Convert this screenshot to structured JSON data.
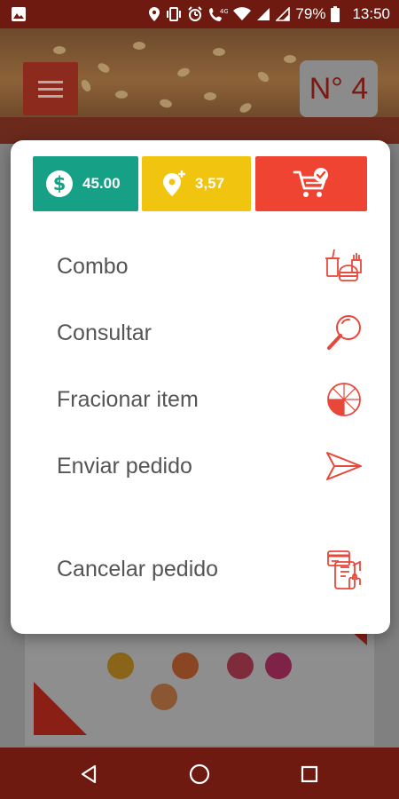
{
  "status_bar": {
    "battery": "79%",
    "time": "13:50"
  },
  "header": {
    "order_number": "N° 4"
  },
  "dialog": {
    "total_value": "45.00",
    "delivery_fee": "3,57",
    "menu_items": [
      {
        "label": "Combo",
        "icon": "combo-food-icon"
      },
      {
        "label": "Consultar",
        "icon": "magnifier-icon"
      },
      {
        "label": "Fracionar item",
        "icon": "pie-fraction-icon"
      },
      {
        "label": "Enviar pedido",
        "icon": "send-icon"
      },
      {
        "label": "Cancelar pedido",
        "icon": "cancel-order-icon"
      }
    ]
  },
  "colors": {
    "status_bar": "#6e1a10",
    "money_chip": "#16a085",
    "delivery_chip": "#f1c40f",
    "cart_chip": "#f04433",
    "accent_red": "#e8483a"
  }
}
